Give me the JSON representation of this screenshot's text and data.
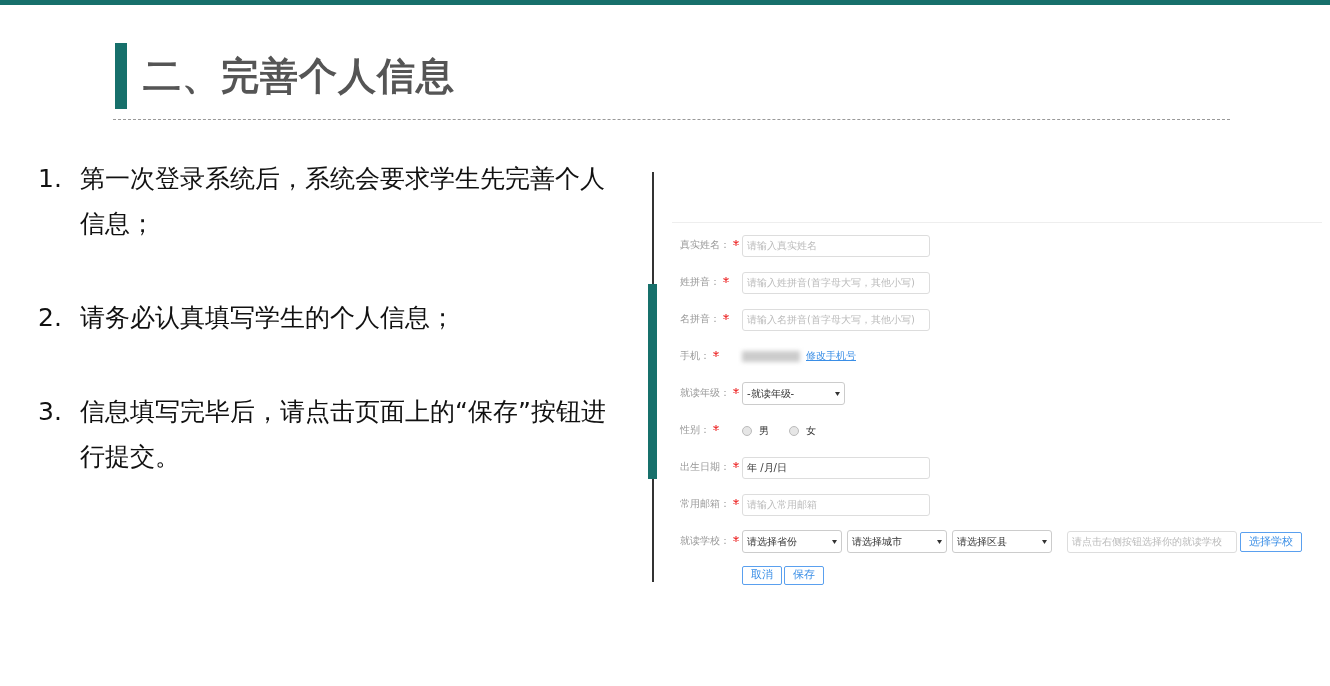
{
  "title": "二、完善个人信息",
  "steps": [
    {
      "number": "1.",
      "text": "第一次登录系统后，系统会要求学生先完善个人信息；"
    },
    {
      "number": "2.",
      "text": "请务必认真填写学生的个人信息；"
    },
    {
      "number": "3.",
      "text": "信息填写完毕后，请点击页面上的“保存”按钮进行提交。"
    }
  ],
  "form": {
    "rows": [
      {
        "kind": "text",
        "label": "真实姓名：",
        "required": true,
        "placeholder": "请输入真实姓名"
      },
      {
        "kind": "text",
        "label": "姓拼音：",
        "required": true,
        "placeholder": "请输入姓拼音(首字母大写，其他小写)"
      },
      {
        "kind": "text",
        "label": "名拼音：",
        "required": true,
        "placeholder": "请输入名拼音(首字母大写，其他小写)"
      },
      {
        "kind": "phone",
        "label": "手机：",
        "required": true,
        "link": "修改手机号"
      },
      {
        "kind": "select",
        "label": "就读年级：",
        "required": true,
        "value": "-就读年级-"
      },
      {
        "kind": "radio",
        "label": "性别：",
        "required": true,
        "options": [
          {
            "label": "男",
            "selected": false
          },
          {
            "label": "女",
            "selected": false
          }
        ]
      },
      {
        "kind": "date",
        "label": "出生日期：",
        "required": true,
        "value": "年 /月/日"
      },
      {
        "kind": "text",
        "label": "常用邮箱：",
        "required": true,
        "placeholder": "请输入常用邮箱"
      },
      {
        "kind": "school",
        "label": "就读学校：",
        "required": true,
        "selects": [
          "请选择省份",
          "请选择城市",
          "请选择区县"
        ],
        "placeholder": "请点击右侧按钮选择你的就读学校",
        "button": "选择学校"
      }
    ],
    "buttons": [
      "取消",
      "保存"
    ]
  }
}
